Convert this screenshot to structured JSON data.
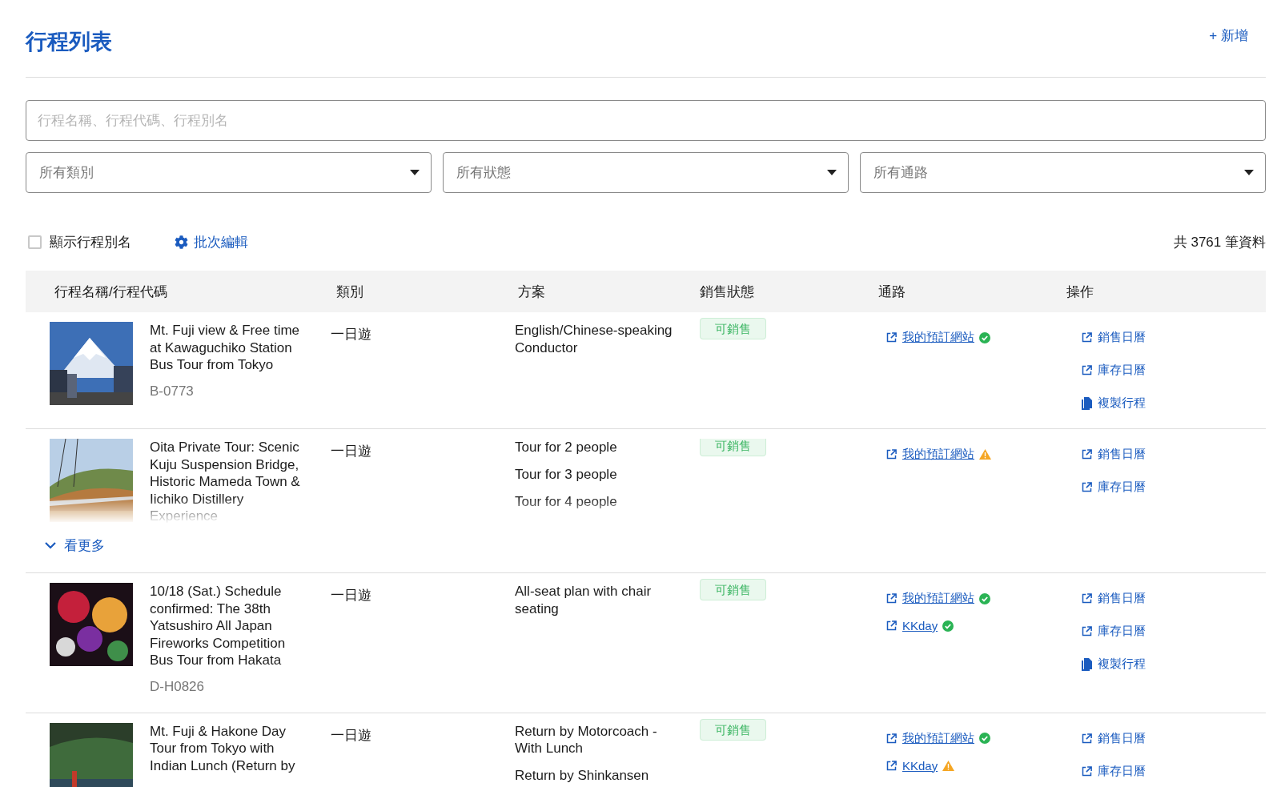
{
  "header": {
    "title": "行程列表",
    "add_button": "+ 新增"
  },
  "search": {
    "placeholder": "行程名稱、行程代碼、行程別名"
  },
  "filters": [
    {
      "placeholder": "所有類別"
    },
    {
      "placeholder": "所有狀態"
    },
    {
      "placeholder": "所有通路"
    }
  ],
  "toolbar": {
    "show_alias": {
      "label": "顯示行程別名",
      "checked": false
    },
    "batch_edit": "批次編輯",
    "total": "共 3761 筆資料"
  },
  "table": {
    "columns": [
      "行程名稱/行程代碼",
      "類別",
      "方案",
      "銷售狀態",
      "通路",
      "操作"
    ],
    "rows": [
      {
        "kind": "picture",
        "title": "Mt. Fuji view & Free time at Kawaguchiko Station Bus Tour from Tokyo",
        "code": "B-0773",
        "category": "一日遊",
        "plans": [
          "English/Chinese-speaking Conductor"
        ],
        "status": {
          "label": "可銷售",
          "kind": "available"
        },
        "channels": [
          {
            "label": "我的預訂網站",
            "verified": true
          }
        ],
        "actions": [
          {
            "label": "銷售日曆",
            "kind": "open"
          },
          {
            "label": "庫存日曆",
            "kind": "open"
          },
          {
            "label": "複製行程",
            "kind": "copy"
          }
        ],
        "expanded": true
      },
      {
        "kind": "picture",
        "title": "Oita Private Tour: Scenic Kuju Suspension Bridge, Historic Mameda Town & Iichiko Distillery Experience",
        "category": "一日遊",
        "plans": [
          "Tour for 2 people",
          "Tour for 3 people",
          "Tour for 4 people"
        ],
        "status": {
          "label": "可銷售",
          "kind": "available"
        },
        "channels": [
          {
            "label": "我的預訂網站",
            "verified": false
          }
        ],
        "actions": [
          {
            "label": "銷售日曆",
            "kind": "open"
          },
          {
            "label": "庫存日曆",
            "kind": "open"
          }
        ],
        "expanded": false,
        "more_label": "看更多"
      },
      {
        "kind": "picture",
        "title": "10/18 (Sat.) Schedule confirmed: The 38th Yatsushiro All Japan Fireworks Competition Bus Tour from Hakata",
        "code": "D-H0826",
        "category": "一日遊",
        "plans": [
          "All-seat plan with chair seating"
        ],
        "status": {
          "label": "可銷售",
          "kind": "available"
        },
        "channels": [
          {
            "label": "我的預訂網站",
            "verified": true
          },
          {
            "label": "KKday",
            "verified": true
          }
        ],
        "actions": [
          {
            "label": "銷售日曆",
            "kind": "open"
          },
          {
            "label": "庫存日曆",
            "kind": "open"
          },
          {
            "label": "複製行程",
            "kind": "copy"
          }
        ],
        "expanded": true
      },
      {
        "kind": "picture",
        "title": "Mt. Fuji & Hakone Day Tour from Tokyo with Indian Lunch (Return by",
        "category": "一日遊",
        "plans": [
          "Return by Motorcoach - With Lunch",
          "Return by Shinkansen"
        ],
        "status": {
          "label": "可銷售",
          "kind": "available"
        },
        "channels": [
          {
            "label": "我的預訂網站",
            "verified": true
          },
          {
            "label": "KKday",
            "verified": false
          }
        ],
        "actions": [
          {
            "label": "銷售日曆",
            "kind": "open"
          },
          {
            "label": "庫存日曆",
            "kind": "open"
          }
        ],
        "expanded": true
      }
    ]
  }
}
